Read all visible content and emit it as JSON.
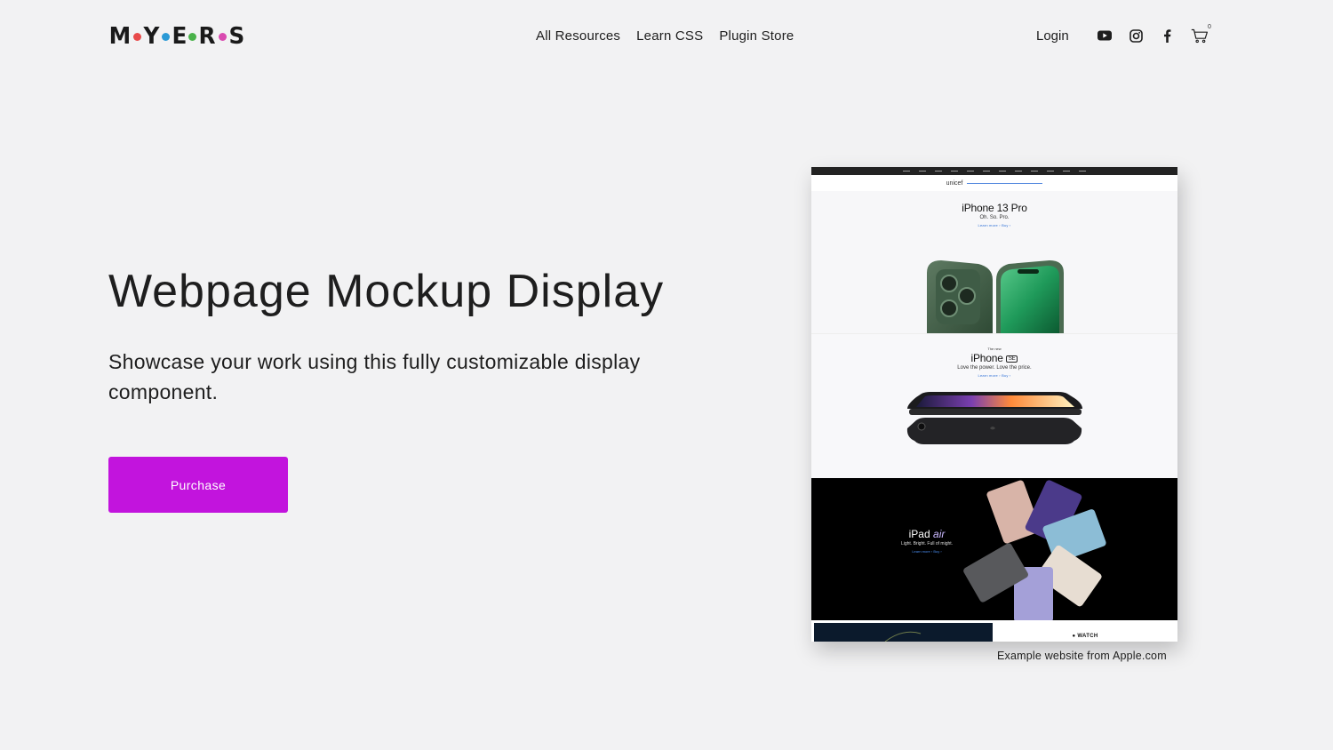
{
  "header": {
    "logo_letters": [
      "M",
      "Y",
      "E",
      "R",
      "S"
    ],
    "nav": [
      "All Resources",
      "Learn CSS",
      "Plugin Store"
    ],
    "login": "Login",
    "cart_count": "0"
  },
  "hero": {
    "title": "Webpage Mockup Display",
    "subtitle": "Showcase your work using this fully customizable display component.",
    "button": "Purchase"
  },
  "mockup": {
    "banner_logo": "unicef",
    "section1": {
      "title": "iPhone 13 Pro",
      "sub": "Oh. So. Pro.",
      "links": "Learn more ›      Buy ›"
    },
    "section2": {
      "pre": "The new",
      "title": "iPhone",
      "badge": "SE",
      "sub": "Love the power. Love the price.",
      "links": "Learn more ›      Buy ›"
    },
    "section3": {
      "title": "iPad",
      "title_accent": "air",
      "sub": "Light. Bright. Full of might.",
      "links": "Learn more ›      Buy ›"
    },
    "section4": {
      "title": "WATCH"
    }
  },
  "caption": "Example website from Apple.com",
  "colors": {
    "accent": "#c214dd",
    "background": "#f2f2f3"
  }
}
